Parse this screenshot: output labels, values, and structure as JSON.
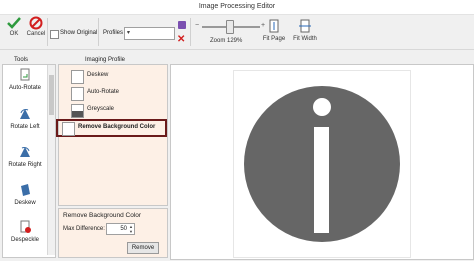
{
  "window": {
    "title": "Image Processing Editor"
  },
  "toolbar": {
    "ok_label": "OK",
    "cancel_label": "Cancel",
    "show_original_label": "Show Original",
    "show_original_checked": false,
    "profiles_label": "Profiles",
    "profiles_value": "-",
    "zoom_label": "Zoom 129%",
    "zoom_level": 1.29,
    "fit_page_label": "Fit Page",
    "fit_width_label": "Fit Width"
  },
  "tools": {
    "header": "Tools",
    "items": [
      {
        "label": "Auto-Rotate",
        "icon": "auto-rotate-icon"
      },
      {
        "label": "Rotate Left",
        "icon": "rotate-left-icon"
      },
      {
        "label": "Rotate Right",
        "icon": "rotate-right-icon"
      },
      {
        "label": "Deskew",
        "icon": "deskew-icon"
      },
      {
        "label": "Despeckle",
        "icon": "despeckle-icon"
      }
    ]
  },
  "profile": {
    "header": "Imaging Profile",
    "items": [
      {
        "label": "Deskew",
        "icon": "deskew-icon"
      },
      {
        "label": "Auto-Rotate",
        "icon": "auto-rotate-icon"
      },
      {
        "label": "Greyscale",
        "icon": "greyscale-icon"
      },
      {
        "label": "Remove Background Color",
        "icon": "remove-background-icon",
        "selected": true
      }
    ]
  },
  "remove_bg": {
    "title": "Remove Background Color",
    "max_diff_label": "Max Difference:",
    "max_diff_value": "50",
    "remove_label": "Remove"
  },
  "colors": {
    "accent": "#6a1a1a",
    "ok_green": "#2e9a3e",
    "cancel_red": "#d21f1f",
    "info_grey": "#666666"
  }
}
